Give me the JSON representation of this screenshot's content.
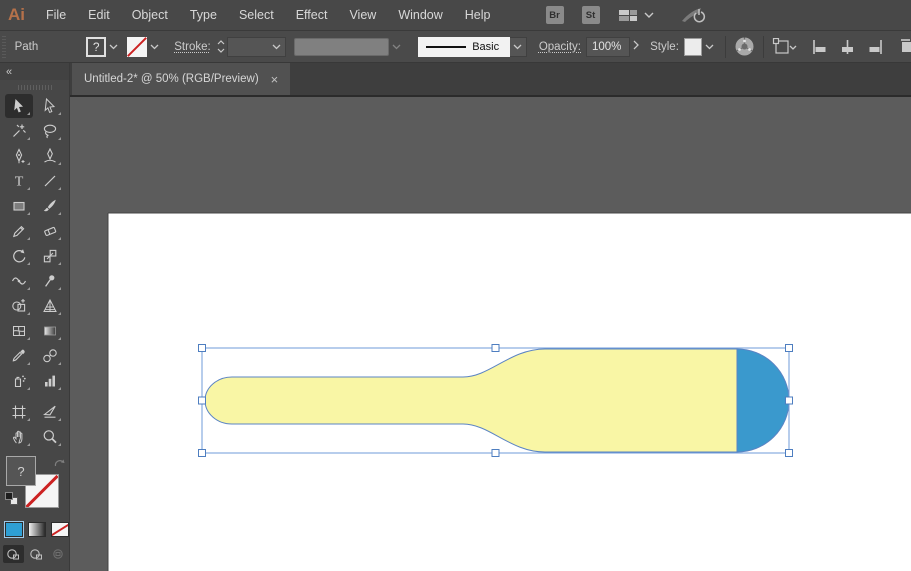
{
  "menu": {
    "logo": "Ai",
    "items": [
      "File",
      "Edit",
      "Object",
      "Type",
      "Select",
      "Effect",
      "View",
      "Window",
      "Help"
    ],
    "right": {
      "bridge_label": "Br",
      "stock_label": "St",
      "workspace_icon": "workspace-switcher-icon",
      "sync_icon": "sync-settings-icon"
    }
  },
  "control_bar": {
    "selection_type_label": "Path",
    "fill_value": "?",
    "stroke_section_label": "Stroke:",
    "brush_name": "Basic",
    "opacity_label": "Opacity:",
    "opacity_value": "100%",
    "style_label": "Style:",
    "icons": [
      "fill-color-swatch",
      "stroke-color-swatch",
      "recolor-artwork-icon",
      "transform-options-icon",
      "align-left-icon",
      "align-horizontal-center-icon",
      "align-right-icon",
      "align-partial-icon"
    ]
  },
  "document_tab": {
    "title": "Untitled-2* @ 50% (RGB/Preview)",
    "close_label": "×"
  },
  "toolbar": {
    "collapse_label": "«",
    "fill_proxy_value": "?",
    "tools": [
      {
        "name": "selection-tool",
        "active": true
      },
      {
        "name": "direct-selection-tool",
        "active": false
      },
      {
        "name": "magic-wand-tool",
        "active": false
      },
      {
        "name": "lasso-tool",
        "active": false
      },
      {
        "name": "pen-tool",
        "active": false
      },
      {
        "name": "curvature-tool",
        "active": false
      },
      {
        "name": "type-tool",
        "active": false
      },
      {
        "name": "line-segment-tool",
        "active": false
      },
      {
        "name": "rectangle-tool",
        "active": false
      },
      {
        "name": "paintbrush-tool",
        "active": false
      },
      {
        "name": "pencil-tool",
        "active": false
      },
      {
        "name": "eraser-tool",
        "active": false
      },
      {
        "name": "rotate-tool",
        "active": false
      },
      {
        "name": "scale-tool",
        "active": false
      },
      {
        "name": "width-tool",
        "active": false
      },
      {
        "name": "puppet-warp-tool",
        "active": false
      },
      {
        "name": "shape-builder-tool",
        "active": false
      },
      {
        "name": "perspective-grid-tool",
        "active": false
      },
      {
        "name": "mesh-tool",
        "active": false
      },
      {
        "name": "gradient-tool",
        "active": false
      },
      {
        "name": "eyedropper-tool",
        "active": false
      },
      {
        "name": "blend-tool",
        "active": false
      },
      {
        "name": "symbol-sprayer-tool",
        "active": false
      },
      {
        "name": "column-graph-tool",
        "active": false
      },
      {
        "name": "artboard-tool",
        "active": false,
        "gap": true
      },
      {
        "name": "slice-tool",
        "active": false,
        "gap": true
      },
      {
        "name": "hand-tool",
        "active": false
      },
      {
        "name": "zoom-tool",
        "active": false
      }
    ],
    "color_buttons": [
      {
        "name": "color-button",
        "selected": true
      },
      {
        "name": "gradient-button",
        "selected": false
      },
      {
        "name": "none-button",
        "selected": false
      }
    ],
    "drawing_modes": [
      {
        "name": "draw-normal-mode",
        "active": true,
        "dim": false
      },
      {
        "name": "draw-behind-mode",
        "active": false,
        "dim": false
      },
      {
        "name": "draw-inside-mode",
        "active": false,
        "dim": true
      }
    ]
  },
  "canvas": {
    "artwork": {
      "shape": "baseball-bat",
      "fill_color": "#F9F6A5",
      "cap_color": "#3A99CD",
      "outline_color": "#5B84C4",
      "selection_color": "#6F9BD8",
      "handle_border_color": "#4E7EC0",
      "handle_fill_color": "#FFFFFF"
    }
  }
}
